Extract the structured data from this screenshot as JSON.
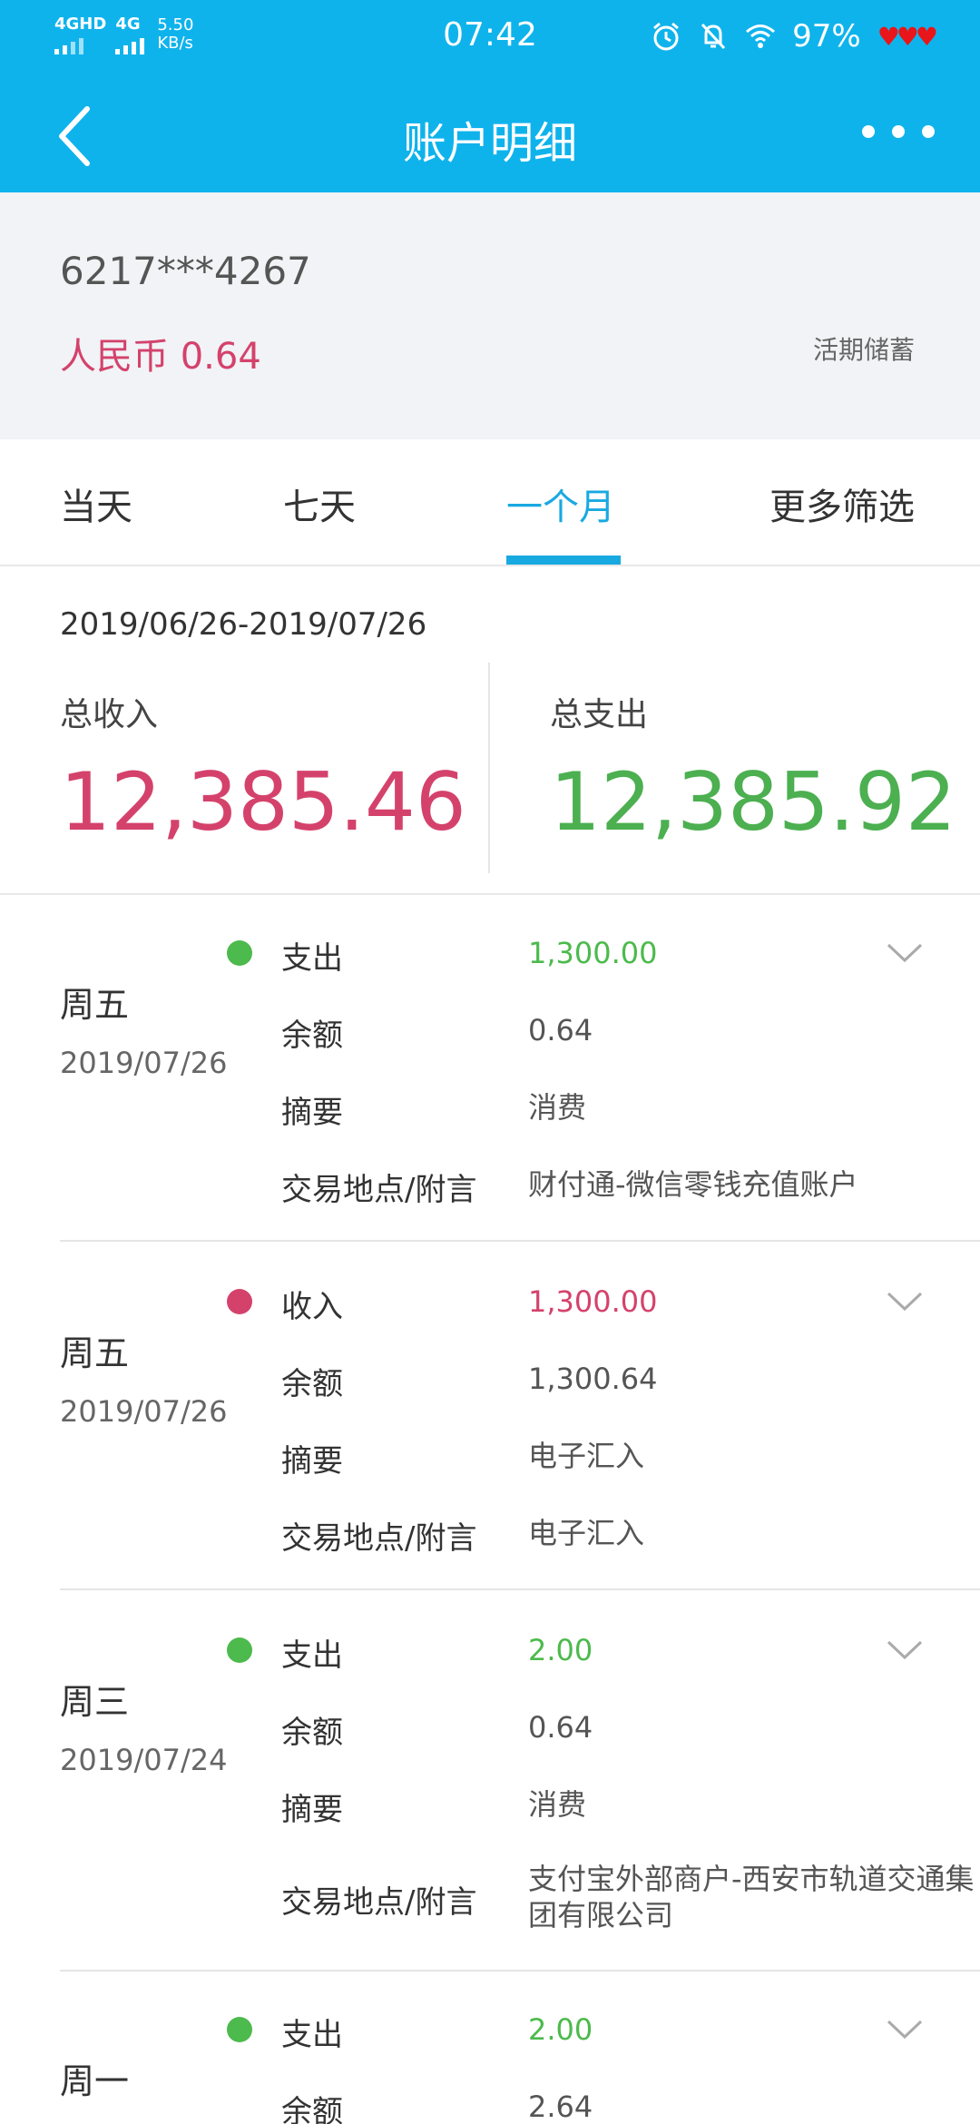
{
  "status": {
    "net1": "4GHD",
    "net2": "4G",
    "speed": "5.50\nKB/s",
    "time": "07:42",
    "battery": "97%"
  },
  "header": {
    "title": "账户明细"
  },
  "account": {
    "number": "6217***4267",
    "balance": "人民币 0.64",
    "type": "活期储蓄"
  },
  "tabs": [
    "当天",
    "七天",
    "一个月",
    "更多筛选"
  ],
  "summary": {
    "range": "2019/06/26-2019/07/26",
    "income_label": "总收入",
    "income_value": "12,385.46",
    "expense_label": "总支出",
    "expense_value": "12,385.92"
  },
  "transactions": [
    {
      "weekday": "周五",
      "date": "2019/07/26",
      "type_label": "支出",
      "amount": "1,300.00",
      "balance_label": "余额",
      "balance": "0.64",
      "summary_label": "摘要",
      "summary": "消费",
      "place_label": "交易地点/附言",
      "place": "财付通-微信零钱充值账户"
    },
    {
      "weekday": "周五",
      "date": "2019/07/26",
      "type_label": "收入",
      "amount": "1,300.00",
      "balance_label": "余额",
      "balance": "1,300.64",
      "summary_label": "摘要",
      "summary": "电子汇入",
      "place_label": "交易地点/附言",
      "place": "电子汇入"
    },
    {
      "weekday": "周三",
      "date": "2019/07/24",
      "type_label": "支出",
      "amount": "2.00",
      "balance_label": "余额",
      "balance": "0.64",
      "summary_label": "摘要",
      "summary": "消费",
      "place_label": "交易地点/附言",
      "place": "支付宝外部商户-西安市轨道交通集团有限公司"
    },
    {
      "weekday": "周一",
      "date": "",
      "type_label": "支出",
      "amount": "2.00",
      "balance_label": "余额",
      "balance": "2.64"
    }
  ]
}
